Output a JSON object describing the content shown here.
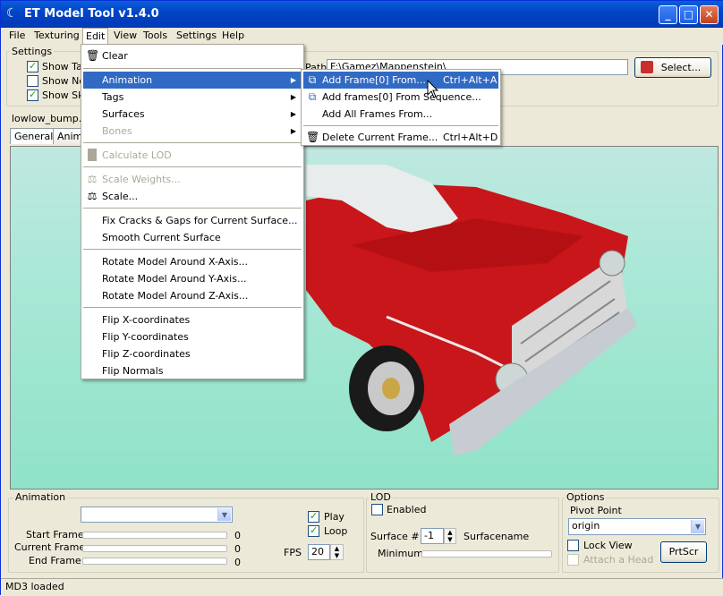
{
  "window": {
    "title": "ET Model Tool v1.4.0"
  },
  "menubar": {
    "file": "File",
    "texturing": "Texturing",
    "edit": "Edit",
    "view": "View",
    "tools": "Tools",
    "settings": "Settings",
    "help": "Help"
  },
  "settings": {
    "label": "Settings",
    "show_tags": "Show Ta",
    "show_normals": "Show No",
    "show_skeleton": "Show Sk",
    "path_label": "Path",
    "path_value": "F:\\Gamez\\Mappenstein\\",
    "select_button": "Select..."
  },
  "model_file": "lowlow_bump.MD3",
  "tabs": [
    "General",
    "Anima"
  ],
  "edit_menu": {
    "clear": "Clear",
    "animation": "Animation",
    "tags": "Tags",
    "surfaces": "Surfaces",
    "bones": "Bones",
    "calculate_lod": "Calculate LOD",
    "scale_weights": "Scale Weights...",
    "scale": "Scale...",
    "fix_cracks": "Fix Cracks & Gaps for Current Surface...",
    "smooth_surface": "Smooth Current Surface",
    "rotate_x": "Rotate Model Around X-Axis...",
    "rotate_y": "Rotate Model Around Y-Axis...",
    "rotate_z": "Rotate Model Around Z-Axis...",
    "flip_x": "Flip X-coordinates",
    "flip_y": "Flip Y-coordinates",
    "flip_z": "Flip Z-coordinates",
    "flip_normals": "Flip Normals"
  },
  "animation_submenu": {
    "add_frame": "Add Frame[0] From...",
    "add_frame_shortcut": "Ctrl+Alt+A",
    "add_frames_sequence": "Add frames[0] From Sequence...",
    "add_all_frames": "Add All Frames From...",
    "delete_frame": "Delete Current Frame...",
    "delete_frame_shortcut": "Ctrl+Alt+D"
  },
  "animation_panel": {
    "label": "Animation",
    "start_frame": "Start Frame",
    "current_frame": "Current Frame",
    "end_frame": "End Frame",
    "start_value": "0",
    "current_value": "0",
    "end_value": "0",
    "play": "Play",
    "loop": "Loop",
    "fps_label": "FPS",
    "fps_value": "20"
  },
  "lod_panel": {
    "label": "LOD",
    "enabled": "Enabled",
    "surface_label": "Surface #",
    "surface_value": "-1",
    "surfacename": "Surfacename",
    "minimum": "Minimum"
  },
  "options_panel": {
    "label": "Options",
    "pivot_point": "Pivot Point",
    "pivot_value": "origin",
    "lock_view": "Lock View",
    "attach_head": "Attach a Head",
    "prtscr": "PrtScr"
  },
  "status": "MD3 loaded"
}
